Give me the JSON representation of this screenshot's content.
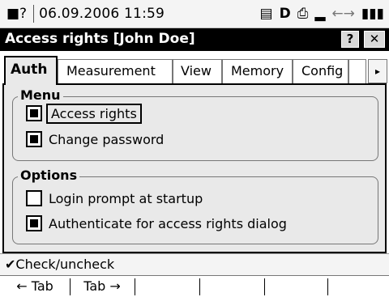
{
  "statusbar": {
    "menu_icon": "■?",
    "datetime": "06.09.2006  11:59",
    "icons": [
      "▤",
      "D",
      "⎙",
      "▂",
      "←→",
      "▮▮▮"
    ]
  },
  "titlebar": {
    "title": "Access rights [John Doe]",
    "help_label": "?",
    "close_label": "✕"
  },
  "tabs": [
    {
      "label": "Auth",
      "active": true
    },
    {
      "label": "Measurement",
      "active": false
    },
    {
      "label": "View",
      "active": false
    },
    {
      "label": "Memory",
      "active": false
    },
    {
      "label": "Config",
      "active": false
    }
  ],
  "tab_scroll_label": "▸",
  "groups": {
    "menu": {
      "legend": "Menu",
      "items": [
        {
          "label": "Access rights",
          "checked": true
        },
        {
          "label": "Change password",
          "checked": true
        }
      ]
    },
    "options": {
      "legend": "Options",
      "items": [
        {
          "label": "Login prompt at startup",
          "checked": false
        },
        {
          "label": "Authenticate for access rights dialog",
          "checked": true
        }
      ]
    }
  },
  "hint": {
    "icon": "✔",
    "text": "Check/uncheck"
  },
  "softkeys": [
    "← Tab",
    "Tab →",
    "",
    "",
    "",
    ""
  ]
}
